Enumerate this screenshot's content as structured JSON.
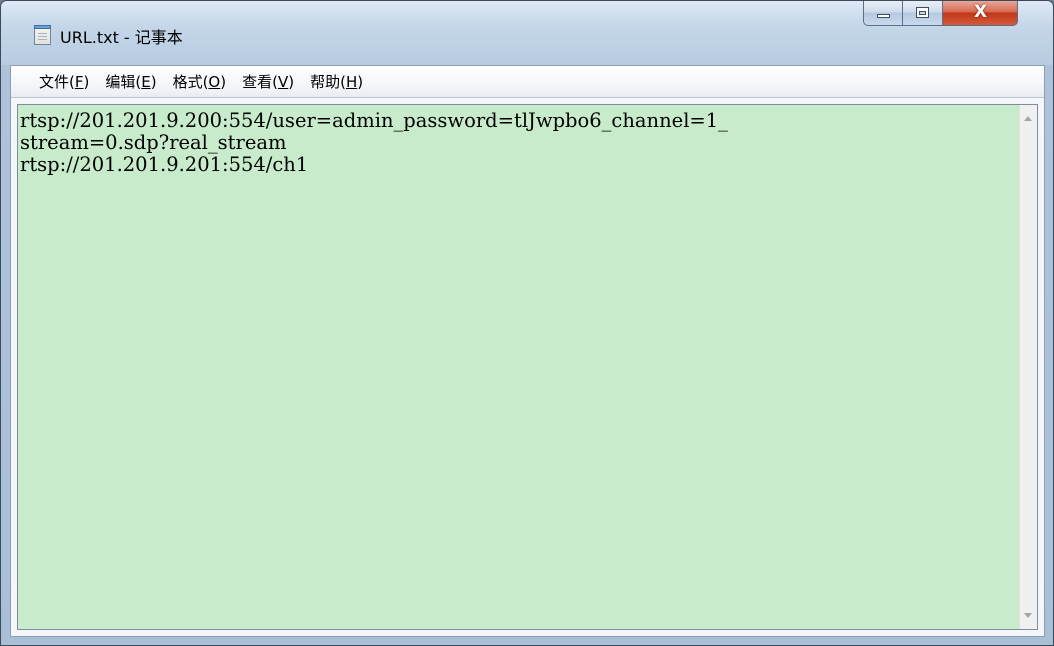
{
  "window": {
    "title": "URL.txt - 记事本",
    "close_glyph": "X"
  },
  "menu": {
    "items": [
      {
        "label": "文件(",
        "accel": "F",
        "tail": ")"
      },
      {
        "label": "编辑(",
        "accel": "E",
        "tail": ")"
      },
      {
        "label": "格式(",
        "accel": "O",
        "tail": ")"
      },
      {
        "label": "查看(",
        "accel": "V",
        "tail": ")"
      },
      {
        "label": "帮助(",
        "accel": "H",
        "tail": ")"
      }
    ]
  },
  "editor": {
    "lines": [
      "rtsp://201.201.9.200:554/user=admin_password=tlJwpbo6_channel=1_",
      "stream=0.sdp?real_stream",
      "rtsp://201.201.9.201:554/ch1"
    ],
    "background": "#c7ebcb"
  },
  "icons": {
    "app": "notepad-icon",
    "minimize": "minimize-icon",
    "maximize": "maximize-icon",
    "close": "close-icon",
    "scroll_up": "scroll-up-arrow-icon",
    "scroll_down": "scroll-down-arrow-icon"
  }
}
